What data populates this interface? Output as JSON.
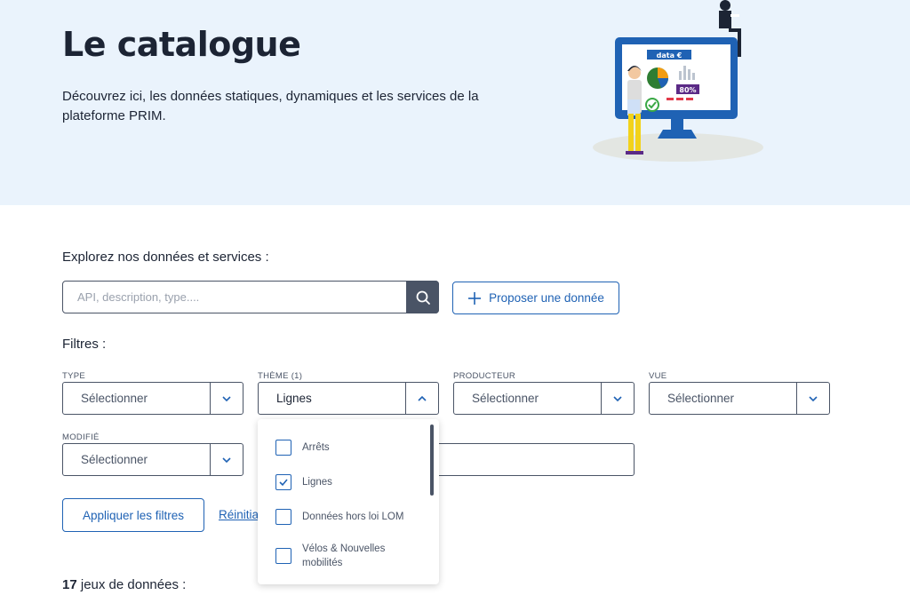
{
  "hero": {
    "title": "Le catalogue",
    "description": "Découvrez ici, les données statiques, dynamiques et les services de la plateforme PRIM.",
    "illustration": {
      "screen_label": "data €",
      "badge": "80%"
    }
  },
  "search": {
    "label": "Explorez nos données et services :",
    "placeholder": "API, description, type....",
    "icon": "search-icon"
  },
  "propose_button": "Proposer une donnée",
  "filters": {
    "label": "Filtres :",
    "type": {
      "label": "TYPE",
      "value": "Sélectionner"
    },
    "theme": {
      "label": "THÈME (1)",
      "value": "Lignes"
    },
    "producer": {
      "label": "PRODUCTEUR",
      "value": "Sélectionner"
    },
    "view": {
      "label": "VUE",
      "value": "Sélectionner"
    },
    "modified": {
      "label": "MODIFIÉ",
      "value": "Sélectionner"
    }
  },
  "theme_options": [
    {
      "label": "Arrêts",
      "checked": false
    },
    {
      "label": "Lignes",
      "checked": true
    },
    {
      "label": "Données hors loi LOM",
      "checked": false
    },
    {
      "label": "Vélos & Nouvelles mobilités",
      "checked": false
    }
  ],
  "apply_button": "Appliquer les filtres",
  "reset_link": "Réinitialiser",
  "results": {
    "count": "17",
    "suffix": " jeux de données :"
  },
  "colors": {
    "hero_bg": "#eaf3fc",
    "accent": "#1f62b4",
    "dark": "#4a5466"
  }
}
